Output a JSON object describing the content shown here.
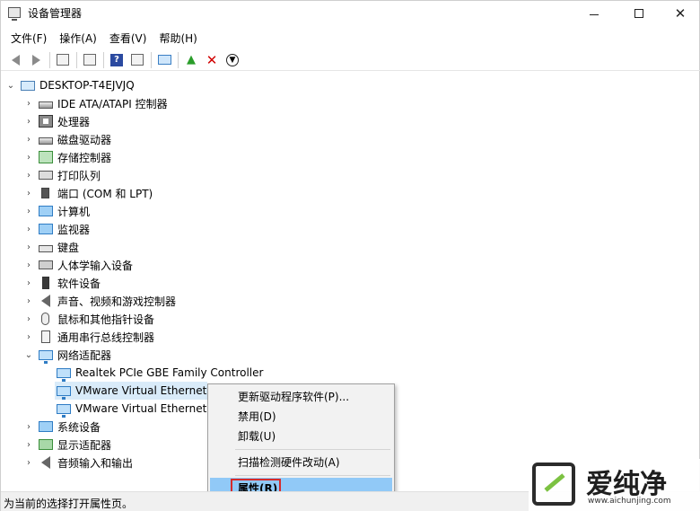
{
  "window": {
    "title": "设备管理器",
    "controls": {
      "minimize": "—",
      "maximize": "",
      "close": "✕"
    }
  },
  "menu": [
    "文件(F)",
    "操作(A)",
    "查看(V)",
    "帮助(H)"
  ],
  "toolbar": {
    "icons": [
      "back-icon",
      "forward-icon",
      "show-hide-tree-icon",
      "properties-icon",
      "help-icon",
      "view-icon",
      "monitor-scan-icon",
      "update-driver-icon",
      "uninstall-icon",
      "disable-icon"
    ]
  },
  "tree": {
    "root": "DESKTOP-T4EJVJQ",
    "items": [
      "IDE ATA/ATAPI 控制器",
      "处理器",
      "磁盘驱动器",
      "存储控制器",
      "打印队列",
      "端口 (COM 和 LPT)",
      "计算机",
      "监视器",
      "键盘",
      "人体学输入设备",
      "软件设备",
      "声音、视频和游戏控制器",
      "鼠标和其他指针设备",
      "通用串行总线控制器",
      "网络适配器"
    ],
    "network_children": [
      "Realtek PCIe GBE Family Controller",
      "VMware Virtual Ethernet",
      "VMware Virtual Ethernet"
    ],
    "after_items": [
      "系统设备",
      "显示适配器",
      "音频输入和输出"
    ]
  },
  "context_menu": {
    "items": [
      "更新驱动程序软件(P)...",
      "禁用(D)",
      "卸载(U)",
      "扫描检测硬件改动(A)",
      "属性(R)"
    ]
  },
  "status": "为当前的选择打开属性页。",
  "watermark": {
    "text": "爱纯净",
    "url": "www.aichunjing.com"
  }
}
